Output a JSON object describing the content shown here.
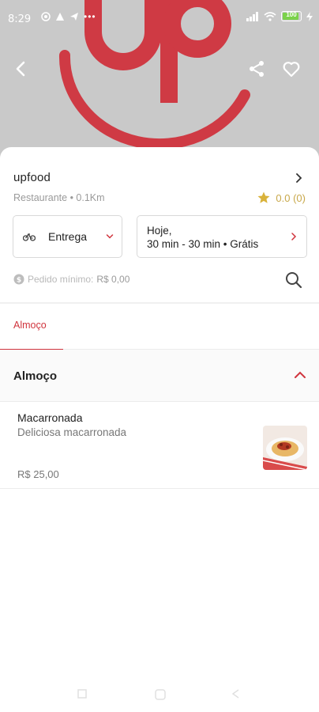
{
  "status_bar": {
    "time": "8:29",
    "battery": "100"
  },
  "header": {
    "logo_text": "up",
    "back_icon": "arrow-left-icon",
    "share_icon": "share-icon",
    "favorite_icon": "heart-outline-icon"
  },
  "store": {
    "name": "upfood",
    "subtitle": "Restaurante • 0.1Km",
    "rating": "0.0 (0)"
  },
  "delivery": {
    "mode_label": "Entrega",
    "schedule_line1": "Hoje,",
    "schedule_line2": "30 min - 30 min • Grátis"
  },
  "min_order": {
    "label": "Pedido mínimo:",
    "value": "R$ 0,00"
  },
  "tabs": [
    {
      "label": "Almoço",
      "active": true
    }
  ],
  "sections": [
    {
      "title": "Almoço",
      "expanded": true,
      "items": [
        {
          "name": "Macarronada",
          "description": "Deliciosa macarronada",
          "price": "R$ 25,00"
        }
      ]
    }
  ],
  "colors": {
    "accent": "#d0343d",
    "rating_star": "#d9b23a",
    "hero_bg": "#c9c9c9"
  }
}
